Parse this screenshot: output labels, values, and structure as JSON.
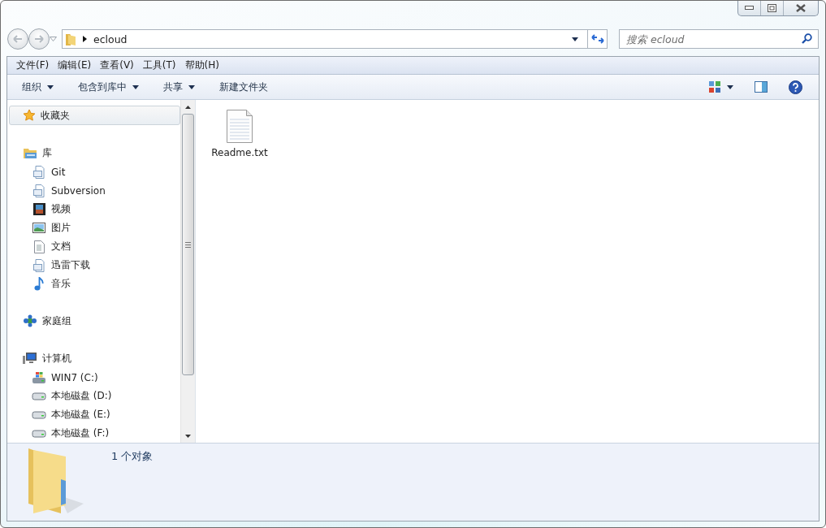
{
  "address_bar": {
    "path": "ecloud",
    "search_placeholder": "搜索 ecloud"
  },
  "menu_bar": [
    "文件(F)",
    "编辑(E)",
    "查看(V)",
    "工具(T)",
    "帮助(H)"
  ],
  "command_bar": [
    {
      "label": "组织",
      "dropdown": true
    },
    {
      "label": "包含到库中",
      "dropdown": true
    },
    {
      "label": "共享",
      "dropdown": true
    },
    {
      "label": "新建文件夹",
      "dropdown": false
    }
  ],
  "sidebar": {
    "items": [
      {
        "label": "收藏夹",
        "selected": true
      },
      {
        "label": "库",
        "selected": false,
        "children": [
          {
            "label": "Git"
          },
          {
            "label": "Subversion"
          },
          {
            "label": "视频"
          },
          {
            "label": "图片"
          },
          {
            "label": "文档"
          },
          {
            "label": "迅雷下载"
          },
          {
            "label": "音乐"
          }
        ]
      },
      {
        "label": "家庭组",
        "selected": false
      },
      {
        "label": "计算机",
        "selected": false,
        "children": [
          {
            "label": "WIN7 (C:)"
          },
          {
            "label": "本地磁盘 (D:)"
          },
          {
            "label": "本地磁盘 (E:)"
          },
          {
            "label": "本地磁盘 (F:)"
          }
        ]
      }
    ]
  },
  "files": [
    {
      "name": "Readme.txt"
    }
  ],
  "details_pane": {
    "summary": "1 个对象"
  }
}
